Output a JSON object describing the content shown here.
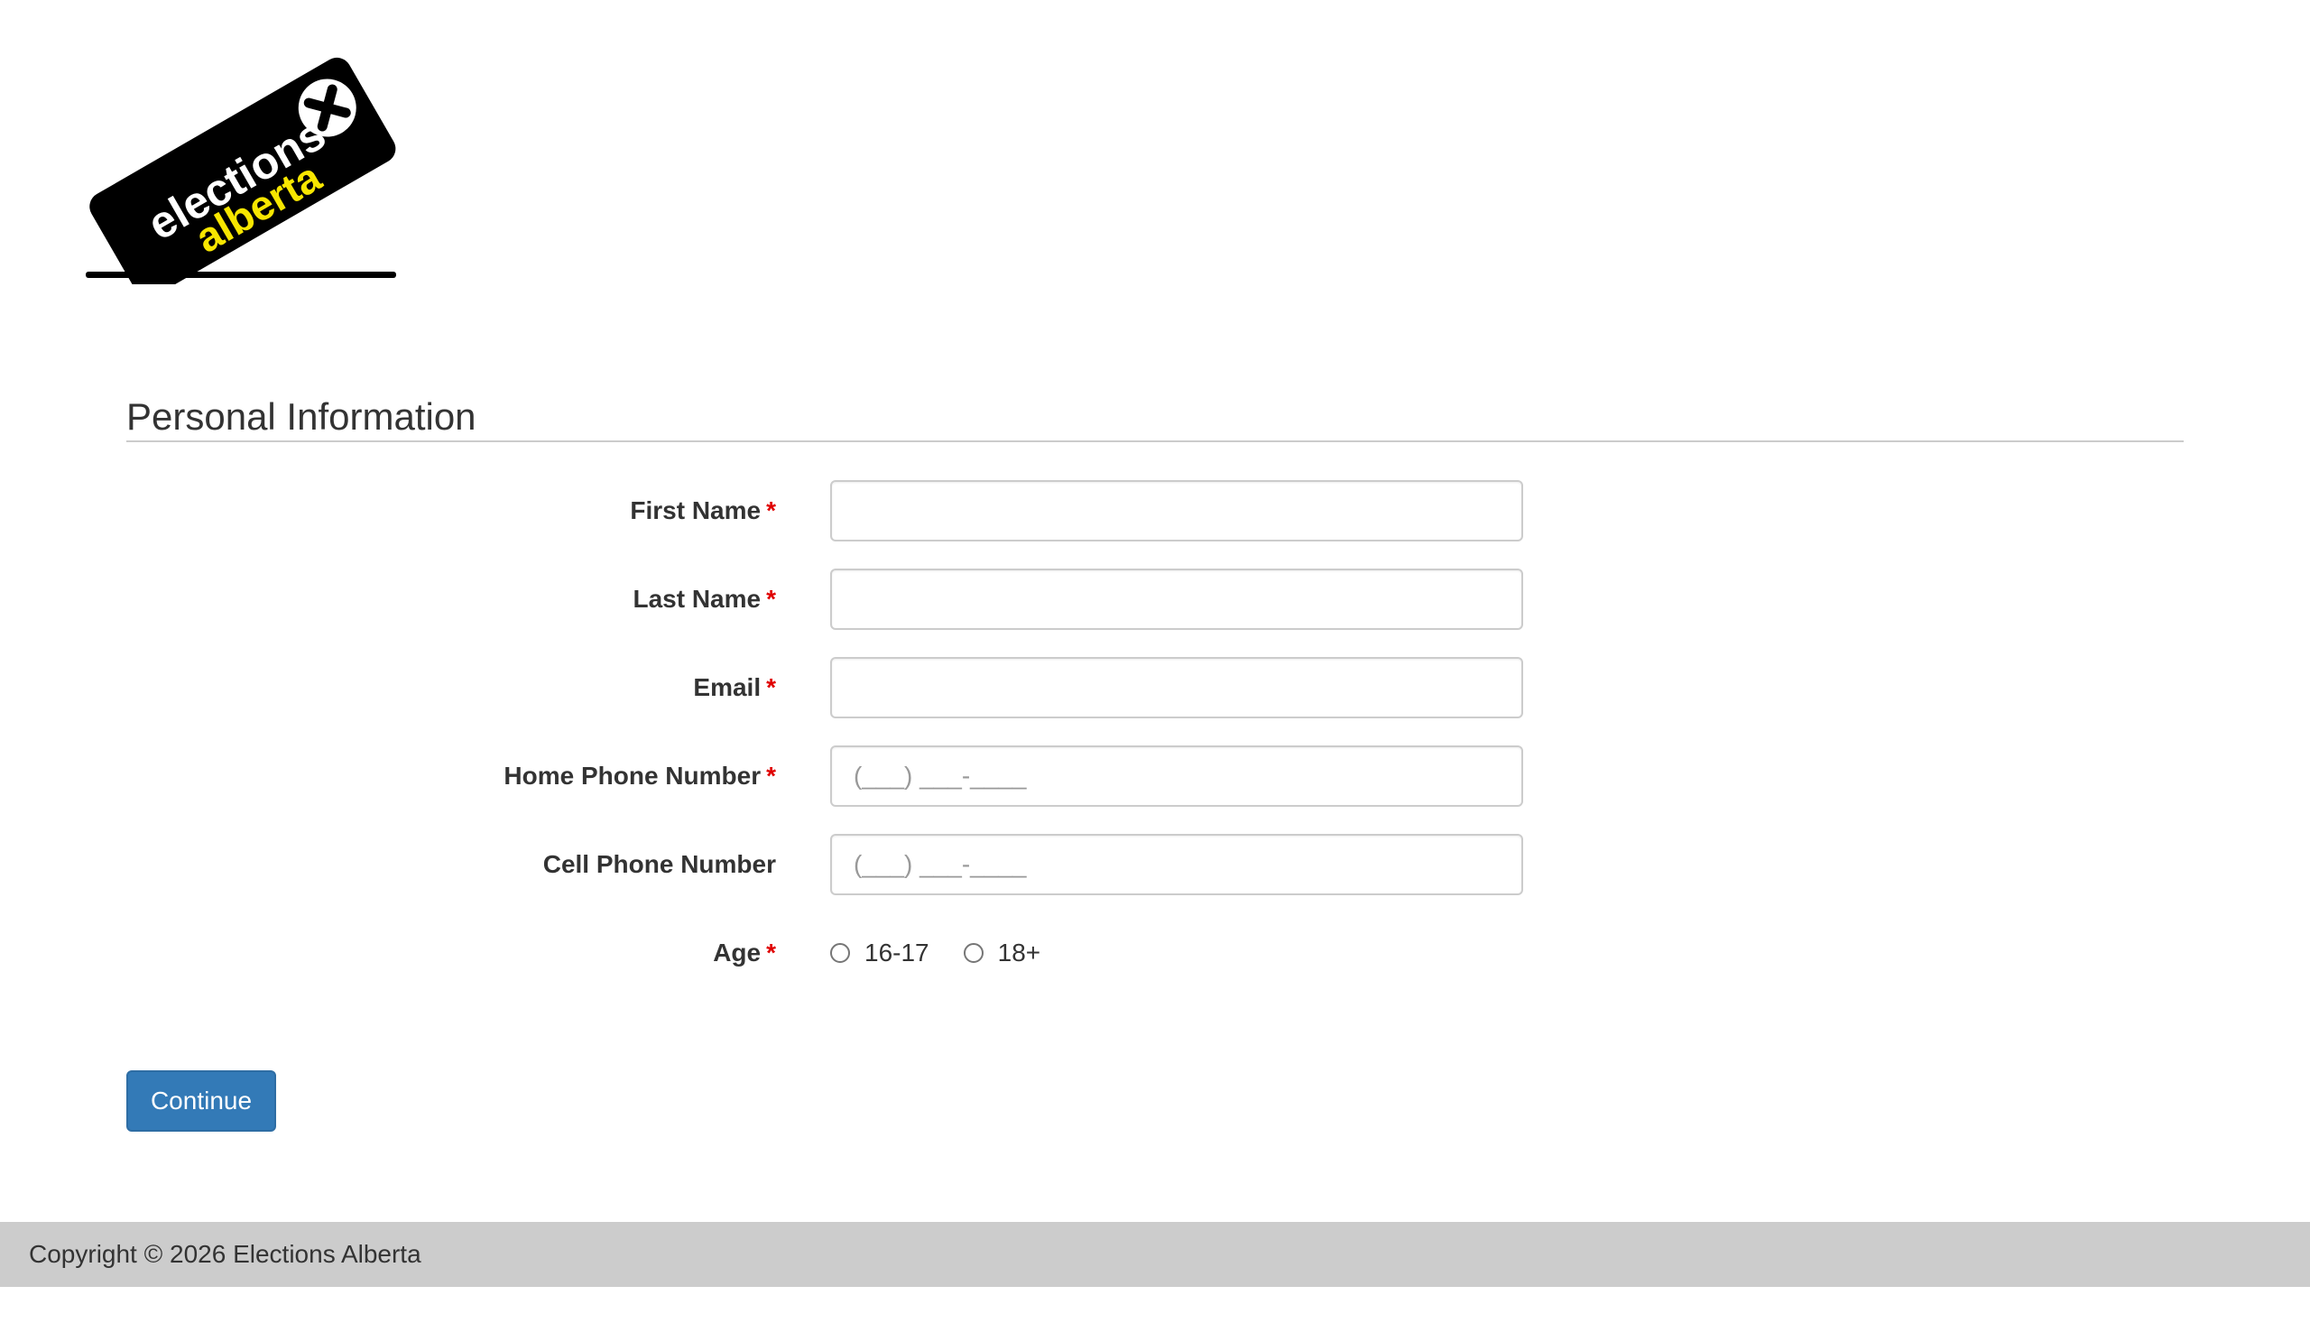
{
  "logo": {
    "line1": "elections",
    "line2": "alberta",
    "mark_color": "#000000",
    "accent_color": "#f7e600"
  },
  "section": {
    "title": "Personal Information"
  },
  "form": {
    "required_marker": "*",
    "first_name": {
      "label": "First Name",
      "value": "",
      "placeholder": ""
    },
    "last_name": {
      "label": "Last Name",
      "value": "",
      "placeholder": ""
    },
    "email": {
      "label": "Email",
      "value": "",
      "placeholder": ""
    },
    "home_phone": {
      "label": "Home Phone Number",
      "value": "",
      "placeholder": "(___) ___-____"
    },
    "cell_phone": {
      "label": "Cell Phone Number",
      "value": "",
      "placeholder": "(___) ___-____"
    },
    "age": {
      "label": "Age",
      "options": [
        "16-17",
        "18+"
      ]
    }
  },
  "actions": {
    "continue_label": "Continue",
    "primary_color": "#337ab7"
  },
  "footer": {
    "copyright": "Copyright © 2026 Elections Alberta"
  }
}
